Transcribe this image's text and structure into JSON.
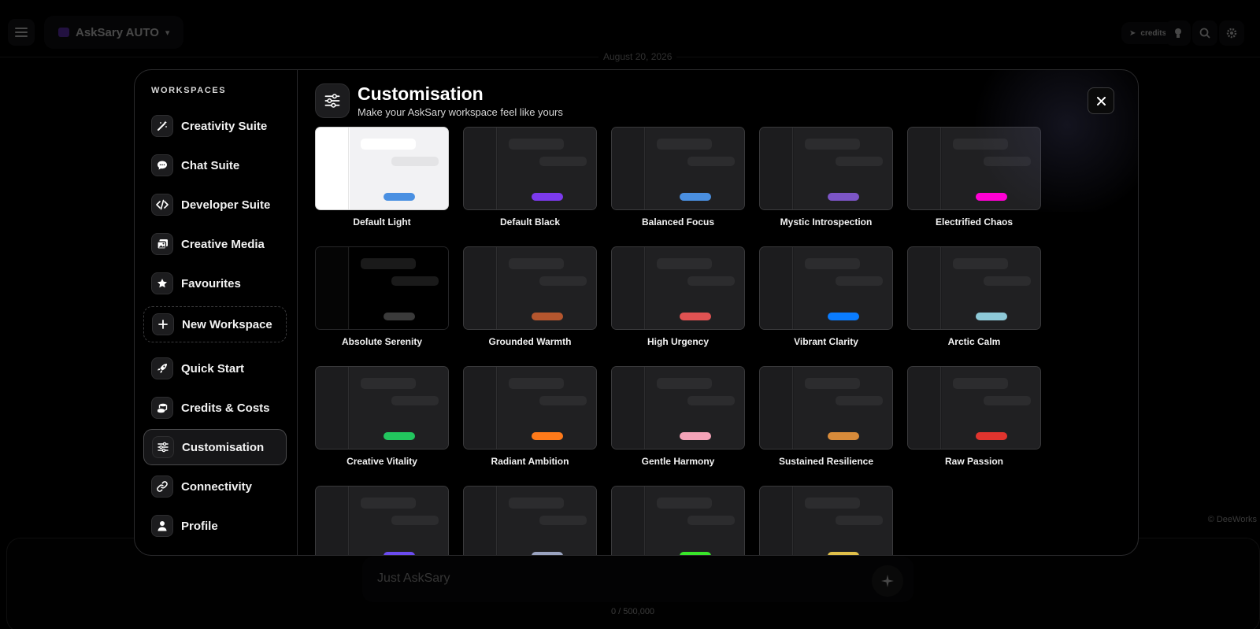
{
  "background": {
    "model_name": "AskSary AUTO",
    "credits": "credits",
    "date": "August 20, 2026",
    "footer": "© DeeWorks",
    "composer_placeholder": "Just AskSary",
    "char_count": "0 / 500,000"
  },
  "sidebar": {
    "heading": "WORKSPACES",
    "items": [
      {
        "label": "Creativity Suite",
        "icon": "magic-wand-icon"
      },
      {
        "label": "Chat Suite",
        "icon": "chat-bubble-icon"
      },
      {
        "label": "Developer Suite",
        "icon": "code-icon"
      },
      {
        "label": "Creative Media",
        "icon": "images-icon"
      },
      {
        "label": "Favourites",
        "icon": "star-icon"
      },
      {
        "label": "New Workspace",
        "icon": "plus-icon"
      },
      {
        "label": "Quick Start",
        "icon": "rocket-icon"
      },
      {
        "label": "Credits & Costs",
        "icon": "coins-icon"
      },
      {
        "label": "Customisation",
        "icon": "sliders-icon",
        "active": true
      },
      {
        "label": "Connectivity",
        "icon": "link-icon"
      },
      {
        "label": "Profile",
        "icon": "user-icon"
      }
    ]
  },
  "header": {
    "title": "Customisation",
    "subtitle": "Make your AskSary workspace feel like yours"
  },
  "themes": [
    {
      "name": "Default Light",
      "accent": "#4a90e2"
    },
    {
      "name": "Default Black",
      "accent": "#7c3aed"
    },
    {
      "name": "Balanced Focus",
      "accent": "#4a8fe0"
    },
    {
      "name": "Mystic Introspection",
      "accent": "#7c55c6"
    },
    {
      "name": "Electrified Chaos",
      "accent": "#ff00d4"
    },
    {
      "name": "Absolute Serenity",
      "accent": "#3a3a3a"
    },
    {
      "name": "Grounded Warmth",
      "accent": "#b5562e"
    },
    {
      "name": "High Urgency",
      "accent": "#e05252"
    },
    {
      "name": "Vibrant Clarity",
      "accent": "#0a7cff"
    },
    {
      "name": "Arctic Calm",
      "accent": "#8ec9d8"
    },
    {
      "name": "Creative Vitality",
      "accent": "#22c55e"
    },
    {
      "name": "Radiant Ambition",
      "accent": "#ff7a1a"
    },
    {
      "name": "Gentle Harmony",
      "accent": "#f4a3b8"
    },
    {
      "name": "Sustained Resilience",
      "accent": "#d88b3a"
    },
    {
      "name": "Raw Passion",
      "accent": "#e0342e"
    },
    {
      "name": "",
      "accent": "#6b4cf0"
    },
    {
      "name": "",
      "accent": "#9aa3c0"
    },
    {
      "name": "",
      "accent": "#39e62a"
    },
    {
      "name": "",
      "accent": "#e0c04a"
    }
  ]
}
